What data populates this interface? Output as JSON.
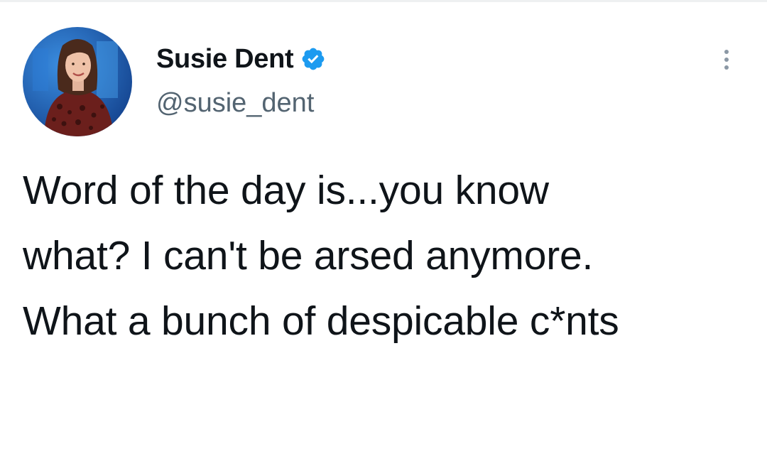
{
  "author": {
    "display_name": "Susie Dent",
    "handle": "@susie_dent",
    "verified": true,
    "verified_color": "#1d9bf0"
  },
  "tweet": {
    "lines": [
      "Word of the day is...you know",
      "what? I can't be arsed anymore.",
      "What a bunch of despicable c*nts"
    ]
  },
  "icons": {
    "verified": "verified-badge-icon",
    "more": "more-options-icon"
  },
  "colors": {
    "text": "#0f1419",
    "secondary_text": "#536471",
    "avatar_background": "#1f6fc9"
  }
}
